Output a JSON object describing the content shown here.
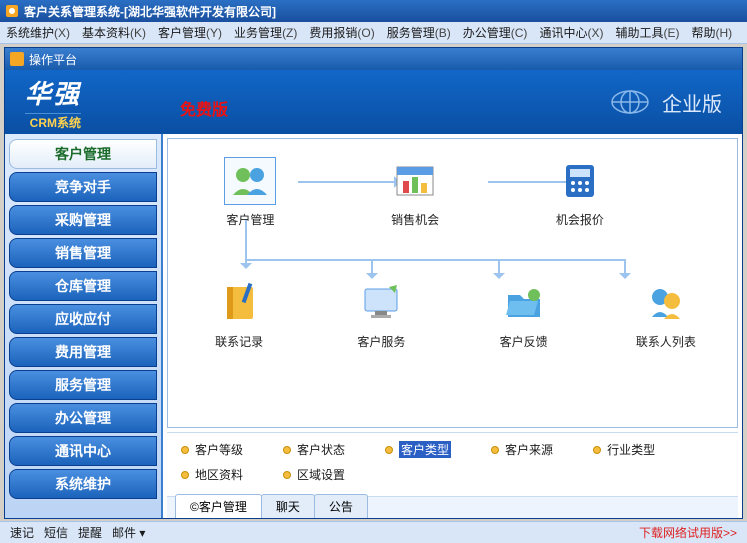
{
  "window": {
    "title": "客户关系管理系统-[湖北华强软件开发有限公司]"
  },
  "menubar": [
    {
      "label": "系统维护",
      "accel": "(X)"
    },
    {
      "label": "基本资料",
      "accel": "(K)"
    },
    {
      "label": "客户管理",
      "accel": "(Y)"
    },
    {
      "label": "业务管理",
      "accel": "(Z)"
    },
    {
      "label": "费用报销",
      "accel": "(O)"
    },
    {
      "label": "服务管理",
      "accel": "(B)"
    },
    {
      "label": "办公管理",
      "accel": "(C)"
    },
    {
      "label": "通讯中心",
      "accel": "(X)"
    },
    {
      "label": "辅助工具",
      "accel": "(E)"
    },
    {
      "label": "帮助",
      "accel": "(H)"
    }
  ],
  "subwin": {
    "title": "操作平台"
  },
  "header": {
    "logo_main": "华强",
    "logo_sub": "CRM系统",
    "free_tag": "免费版",
    "edition": "企业版"
  },
  "sidebar": [
    "客户管理",
    "竞争对手",
    "采购管理",
    "销售管理",
    "仓库管理",
    "应收应付",
    "费用管理",
    "服务管理",
    "办公管理",
    "通讯中心",
    "系统维护"
  ],
  "flow_top": [
    {
      "icon": "people",
      "label": "客户管理",
      "boxed": true
    },
    {
      "icon": "chart",
      "label": "销售机会",
      "boxed": false
    },
    {
      "icon": "calc",
      "label": "机会报价",
      "boxed": false
    }
  ],
  "flow_bottom": [
    {
      "icon": "notebook",
      "label": "联系记录"
    },
    {
      "icon": "monitor",
      "label": "客户服务"
    },
    {
      "icon": "folder",
      "label": "客户反馈"
    },
    {
      "icon": "contacts",
      "label": "联系人列表"
    }
  ],
  "link_rows": [
    [
      {
        "label": "客户等级",
        "sel": false
      },
      {
        "label": "客户状态",
        "sel": false
      },
      {
        "label": "客户类型",
        "sel": true
      },
      {
        "label": "客户来源",
        "sel": false
      },
      {
        "label": "行业类型",
        "sel": false
      }
    ],
    [
      {
        "label": "地区资料",
        "sel": false
      },
      {
        "label": "区域设置",
        "sel": false
      }
    ]
  ],
  "tabs": [
    {
      "label": "©客户管理",
      "active": true
    },
    {
      "label": "聊天",
      "active": false
    },
    {
      "label": "公告",
      "active": false
    }
  ],
  "statusbar": {
    "left": [
      "速记",
      "短信",
      "提醒",
      "邮件 ▾"
    ],
    "right": "下载网络试用版>>"
  }
}
